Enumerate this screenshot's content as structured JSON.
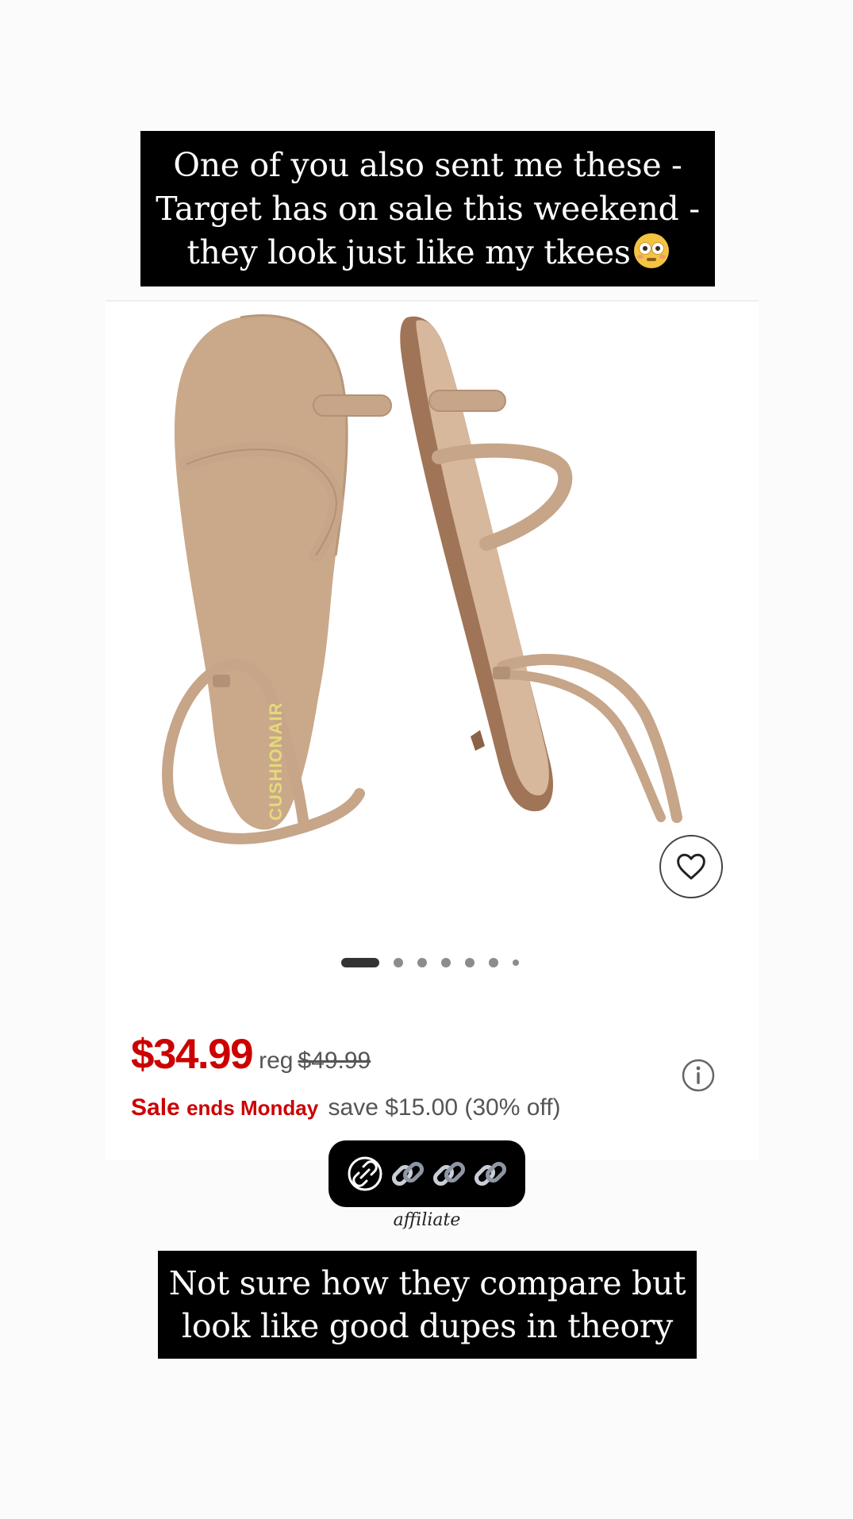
{
  "caption_top": {
    "lines": [
      "One of you also sent me these -",
      "Target has on sale this weekend -",
      "they look just like my tkees"
    ],
    "emoji": "flushed-face"
  },
  "product": {
    "brand_imprint": "CUSHIONAIR",
    "sale_price": "$34.99",
    "reg_label": "reg",
    "reg_price": "$49.99",
    "sale_ends_prefix": "Sale",
    "sale_ends_suffix": "ends Monday",
    "save_text": "save $15.00 (30% off)",
    "carousel": {
      "total": 7,
      "active_index": 0
    },
    "colors": {
      "sale_red": "#cc0000",
      "sandal_tan": "#c9a98a"
    }
  },
  "link_sticker": {
    "icon": "link-icon",
    "emoji_count": 3
  },
  "affiliate_label": "affiliate",
  "caption_bottom": {
    "lines": [
      "Not sure how they compare but",
      "look like good dupes in theory"
    ]
  }
}
